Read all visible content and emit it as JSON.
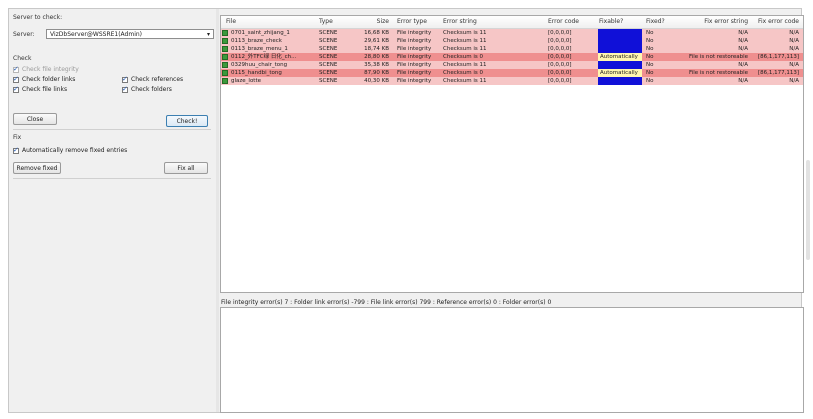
{
  "left_panel": {
    "server_label": "Server to check:",
    "server_prefix": "Server:",
    "server_value": "VizDbServer@WSSRE1(Admin)",
    "check_label": "Check",
    "check_file_integrity": "Check file integrity",
    "check_folder_links": "Check folder links",
    "check_references": "Check references",
    "check_file_links": "Check file links",
    "check_folders": "Check folders",
    "close_label": "Close",
    "check_button_label": "Check!",
    "fix_label": "Fix",
    "auto_remove_label": "Automatically remove fixed entries",
    "remove_fixed_label": "Remove fixed",
    "fix_all_label": "Fix all"
  },
  "table": {
    "headers": [
      "File",
      "Type",
      "Size",
      "Error type",
      "Error string",
      "Error code",
      "Fixable?",
      "Fixed?",
      "Fix error string",
      "Fix error code"
    ],
    "rows": [
      {
        "file": "0701_saint_zhijang_1",
        "type": "SCENE",
        "size": "16,68 KB",
        "etype": "File integrity",
        "estring": "Checksum is 11",
        "ecode": "[0,0,0,0]",
        "fixable": "",
        "fixed": "No",
        "fstring": "N/A",
        "fcode": "N/A",
        "bg": "#f6c6c6",
        "fixable_bg": "#1010d8"
      },
      {
        "file": "0113_braze_check",
        "type": "SCENE",
        "size": "29,61 KB",
        "etype": "File integrity",
        "estring": "Checksum is 11",
        "ecode": "[0,0,0,0]",
        "fixable": "",
        "fixed": "No",
        "fstring": "N/A",
        "fcode": "N/A",
        "bg": "#f6c6c6",
        "fixable_bg": "#1010d8"
      },
      {
        "file": "0113_braze_menu_1",
        "type": "SCENE",
        "size": "18,74 KB",
        "etype": "File integrity",
        "estring": "Checksum is 11",
        "ecode": "[0,0,0,0]",
        "fixable": "",
        "fixed": "No",
        "fstring": "N/A",
        "fcode": "N/A",
        "bg": "#f6c6c6",
        "fixable_bg": "#1010d8"
      },
      {
        "file": "0112_外TFC绿 日化_ch...",
        "type": "SCENE",
        "size": "28,80 KB",
        "etype": "File integrity",
        "estring": "Checksum is 0",
        "ecode": "[0,0,0,0]",
        "fixable": "Automatically",
        "fixed": "No",
        "fstring": "File is not restoreable",
        "fcode": "[86,1,177,113]",
        "bg": "#ef8f8f",
        "fixable_bg": "#fff7b0"
      },
      {
        "file": "0329huu_chair_tong",
        "type": "SCENE",
        "size": "35,38 KB",
        "etype": "File integrity",
        "estring": "Checksum is 11",
        "ecode": "[0,0,0,0]",
        "fixable": "",
        "fixed": "No",
        "fstring": "N/A",
        "fcode": "N/A",
        "bg": "#f6c6c6",
        "fixable_bg": "#1010d8"
      },
      {
        "file": "0115_handbi_tong",
        "type": "SCENE",
        "size": "87,90 KB",
        "etype": "File integrity",
        "estring": "Checksum is 0",
        "ecode": "[0,0,0,0]",
        "fixable": "Automatically",
        "fixed": "No",
        "fstring": "File is not restoreable",
        "fcode": "[86,1,177,113]",
        "bg": "#ef8f8f",
        "fixable_bg": "#fff7b0"
      },
      {
        "file": "glaze_lotte",
        "type": "SCENE",
        "size": "40,30 KB",
        "etype": "File integrity",
        "estring": "Checksum is 11",
        "ecode": "[0,0,0,0]",
        "fixable": "",
        "fixed": "No",
        "fstring": "N/A",
        "fcode": "N/A",
        "bg": "#f6c6c6",
        "fixable_bg": "#1010d8"
      }
    ]
  },
  "status_line": "File integrity error(s) 7 : Folder link error(s) -799 : File link error(s) 799 : Reference error(s) 0 : Folder error(s) 0"
}
